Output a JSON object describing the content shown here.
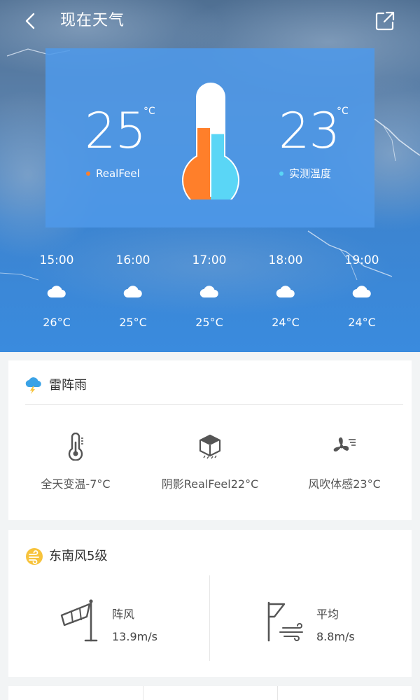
{
  "header": {
    "title": "现在天气"
  },
  "current": {
    "realfeel": {
      "value": "25",
      "unit": "°C",
      "label": "RealFeel",
      "color": "#ff7f2a"
    },
    "actual": {
      "value": "23",
      "unit": "°C",
      "label": "实测温度",
      "color": "#5ad6f6"
    },
    "thermometer": {
      "realfeel_fill": 0.6,
      "actual_fill": 0.55
    }
  },
  "hourly": [
    {
      "time": "15:00",
      "icon": "cloud-icon",
      "temp": "26°C"
    },
    {
      "time": "16:00",
      "icon": "cloud-icon",
      "temp": "25°C"
    },
    {
      "time": "17:00",
      "icon": "cloud-icon",
      "temp": "25°C"
    },
    {
      "time": "18:00",
      "icon": "cloud-icon",
      "temp": "24°C"
    },
    {
      "time": "19:00",
      "icon": "cloud-icon",
      "temp": "24°C"
    }
  ],
  "condition_card": {
    "title": "雷阵雨",
    "icon": "thunderstorm-icon",
    "stats": [
      {
        "icon": "thermometer-icon",
        "text": "全天变温-7°C"
      },
      {
        "icon": "shade-cube-icon",
        "text": "阴影RealFeel22°C"
      },
      {
        "icon": "fan-icon",
        "text": "风吹体感23°C"
      }
    ]
  },
  "wind_card": {
    "title": "东南风5级",
    "icon": "wind-icon",
    "gust": {
      "icon": "windsock-icon",
      "label": "阵风",
      "value": "13.9m/s"
    },
    "average": {
      "icon": "flag-icon",
      "label": "平均",
      "value": "8.8m/s"
    }
  },
  "colors": {
    "accent_orange": "#ff7f2a",
    "accent_cyan": "#5ad6f6",
    "panel_blue": "#4e98e8",
    "wind_yellow": "#f7c33c",
    "storm_blue": "#3aa2e6"
  }
}
